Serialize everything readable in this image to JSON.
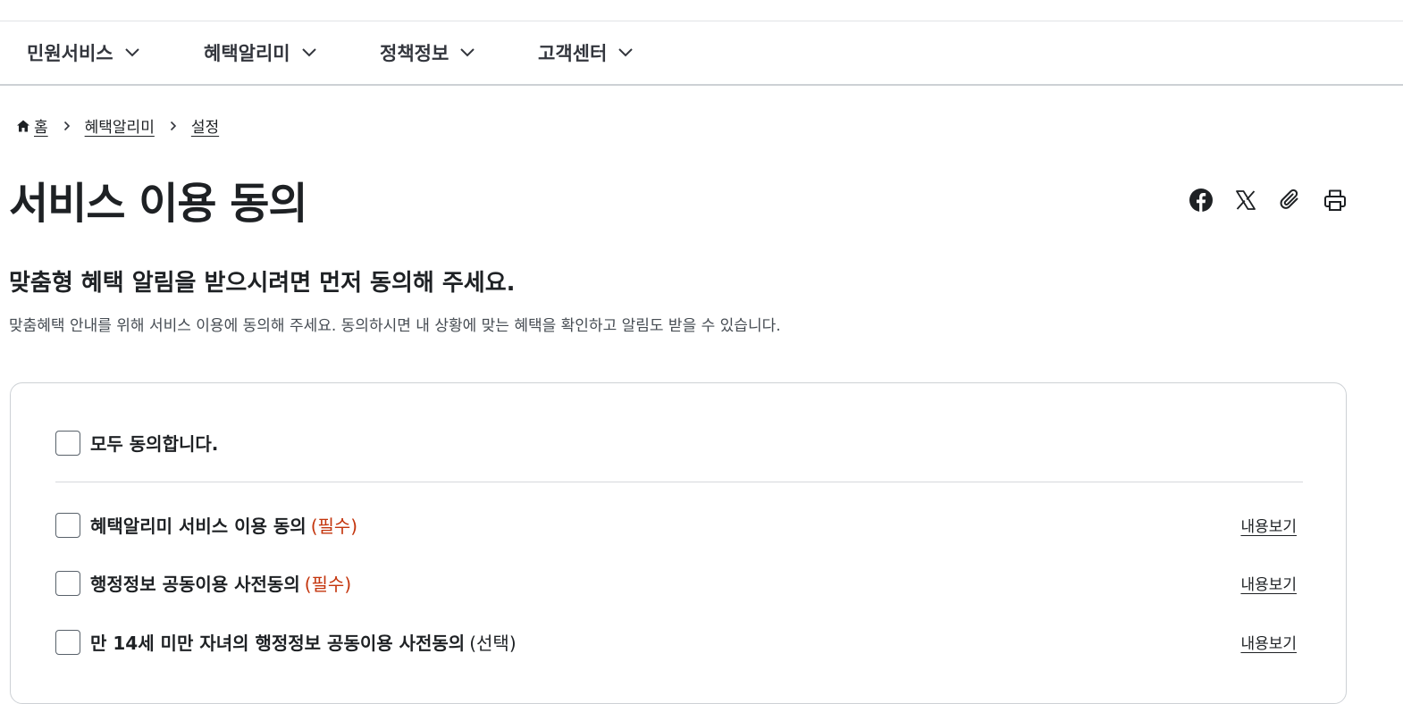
{
  "nav": {
    "items": [
      {
        "label": "민원서비스"
      },
      {
        "label": "혜택알리미"
      },
      {
        "label": "정책정보"
      },
      {
        "label": "고객센터"
      }
    ]
  },
  "breadcrumb": {
    "home": "홈",
    "items": [
      "혜택알리미",
      "설정"
    ]
  },
  "page": {
    "title": "서비스 이용 동의",
    "subheading": "맞춤형 혜택 알림을 받으시려면 먼저 동의해 주세요.",
    "description": "맞춤혜택 안내를 위해 서비스 이용에 동의해 주세요. 동의하시면 내 상황에 맞는 혜택을 확인하고 알림도 받을 수 있습니다."
  },
  "share": {
    "icons": [
      "facebook-icon",
      "x-icon",
      "paperclip-icon",
      "print-icon"
    ]
  },
  "agreement": {
    "all_label": "모두 동의합니다.",
    "items": [
      {
        "label": "혜택알리미 서비스 이용 동의",
        "tag": "(필수)",
        "link": "내용보기"
      },
      {
        "label": "행정정보 공동이용 사전동의",
        "tag": "(필수)",
        "link": "내용보기"
      },
      {
        "label": "만 14세 미만 자녀의 행정정보 공동이용 사전동의",
        "tag": "(선택)",
        "link": "내용보기"
      }
    ]
  },
  "colors": {
    "required": "#c4350d",
    "text": "#1e2124",
    "border": "#cdd1d5"
  }
}
